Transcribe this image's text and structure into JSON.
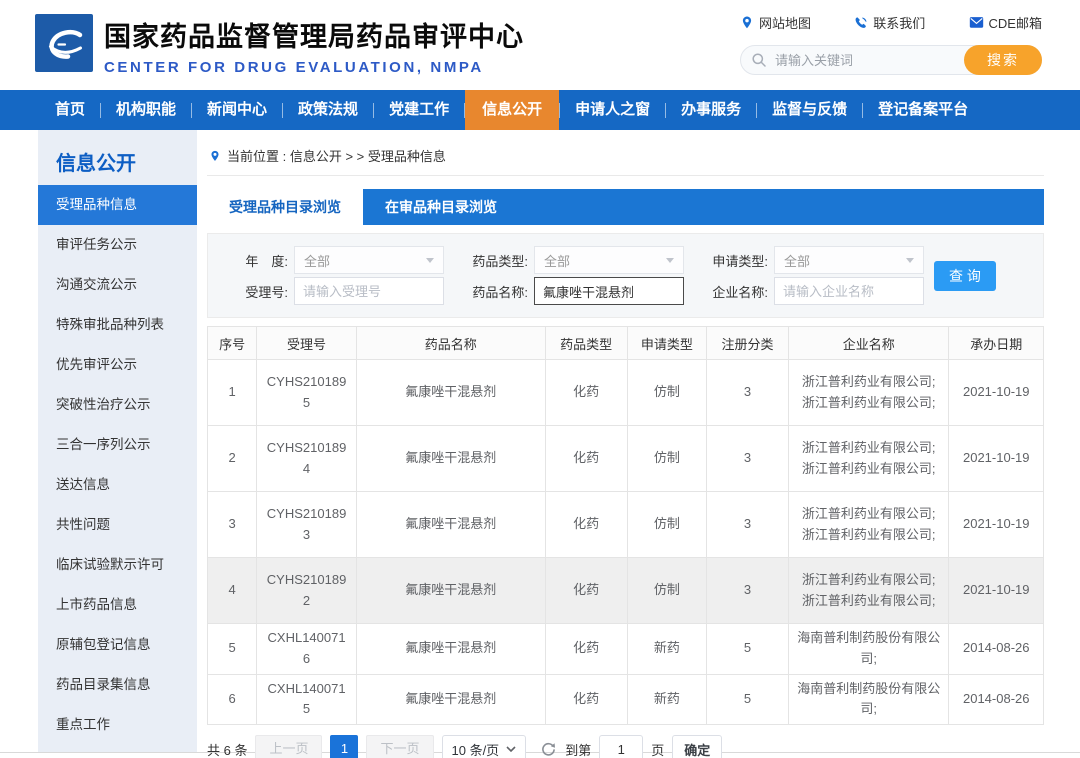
{
  "header": {
    "title": "国家药品监督管理局药品审评中心",
    "subtitle": "CENTER FOR DRUG EVALUATION, NMPA",
    "links": {
      "sitemap": "网站地图",
      "contact": "联系我们",
      "mail": "CDE邮箱"
    },
    "search": {
      "placeholder": "请输入关键词",
      "button": "搜索"
    }
  },
  "nav": {
    "items": [
      "首页",
      "机构职能",
      "新闻中心",
      "政策法规",
      "党建工作",
      "信息公开",
      "申请人之窗",
      "办事服务",
      "监督与反馈",
      "登记备案平台"
    ],
    "active_index": 5
  },
  "sidebar": {
    "title": "信息公开",
    "items": [
      "受理品种信息",
      "审评任务公示",
      "沟通交流公示",
      "特殊审批品种列表",
      "优先审评公示",
      "突破性治疗公示",
      "三合一序列公示",
      "送达信息",
      "共性问题",
      "临床试验默示许可",
      "上市药品信息",
      "原辅包登记信息",
      "药品目录集信息",
      "重点工作"
    ],
    "active_index": 0
  },
  "breadcrumb": {
    "text": "当前位置 : 信息公开 >  >  受理品种信息"
  },
  "tabs": {
    "items": [
      "受理品种目录浏览",
      "在审品种目录浏览"
    ],
    "active_index": 0
  },
  "filter": {
    "year_label": "年　度:",
    "year_value": "全部",
    "drug_type_label": "药品类型:",
    "drug_type_value": "全部",
    "apply_type_label": "申请类型:",
    "apply_type_value": "全部",
    "accept_no_label": "受理号:",
    "accept_no_placeholder": "请输入受理号",
    "drug_name_label": "药品名称:",
    "drug_name_value": "氟康唑干混悬剂",
    "company_label": "企业名称:",
    "company_placeholder": "请输入企业名称",
    "submit": "查 询"
  },
  "table": {
    "columns": [
      "序号",
      "受理号",
      "药品名称",
      "药品类型",
      "申请类型",
      "注册分类",
      "企业名称",
      "承办日期"
    ],
    "col_widths": [
      "5.9%",
      "11.9%",
      "22.6%",
      "9.8%",
      "9.5%",
      "9.8%",
      "19.2%",
      "11.3%"
    ],
    "rows": [
      [
        "1",
        "CYHS2101895",
        "氟康唑干混悬剂",
        "化药",
        "仿制",
        "3",
        "浙江普利药业有限公司;浙江普利药业有限公司;",
        "2021-10-19"
      ],
      [
        "2",
        "CYHS2101894",
        "氟康唑干混悬剂",
        "化药",
        "仿制",
        "3",
        "浙江普利药业有限公司;浙江普利药业有限公司;",
        "2021-10-19"
      ],
      [
        "3",
        "CYHS2101893",
        "氟康唑干混悬剂",
        "化药",
        "仿制",
        "3",
        "浙江普利药业有限公司;浙江普利药业有限公司;",
        "2021-10-19"
      ],
      [
        "4",
        "CYHS2101892",
        "氟康唑干混悬剂",
        "化药",
        "仿制",
        "3",
        "浙江普利药业有限公司;浙江普利药业有限公司;",
        "2021-10-19"
      ],
      [
        "5",
        "CXHL1400716",
        "氟康唑干混悬剂",
        "化药",
        "新药",
        "5",
        "海南普利制药股份有限公司;",
        "2014-08-26"
      ],
      [
        "6",
        "CXHL1400715",
        "氟康唑干混悬剂",
        "化药",
        "新药",
        "5",
        "海南普利制药股份有限公司;",
        "2014-08-26"
      ]
    ],
    "highlighted_row_index": 3
  },
  "pagination": {
    "total": "共 6 条",
    "prev": "上一页",
    "current_page": "1",
    "next": "下一页",
    "page_size": "10 条/页",
    "goto_label": "到第",
    "goto_value": "1",
    "page_unit": "页",
    "confirm": "确定"
  },
  "colors": {
    "nav_blue": "#1568c4",
    "active_orange": "#e8872e",
    "search_orange": "#f7a32b",
    "sidebar_active_blue": "#2478d8",
    "tab_blue": "#1b76d3",
    "query_blue": "#2b9bf4",
    "pagination_active_blue": "#1a73d9"
  }
}
